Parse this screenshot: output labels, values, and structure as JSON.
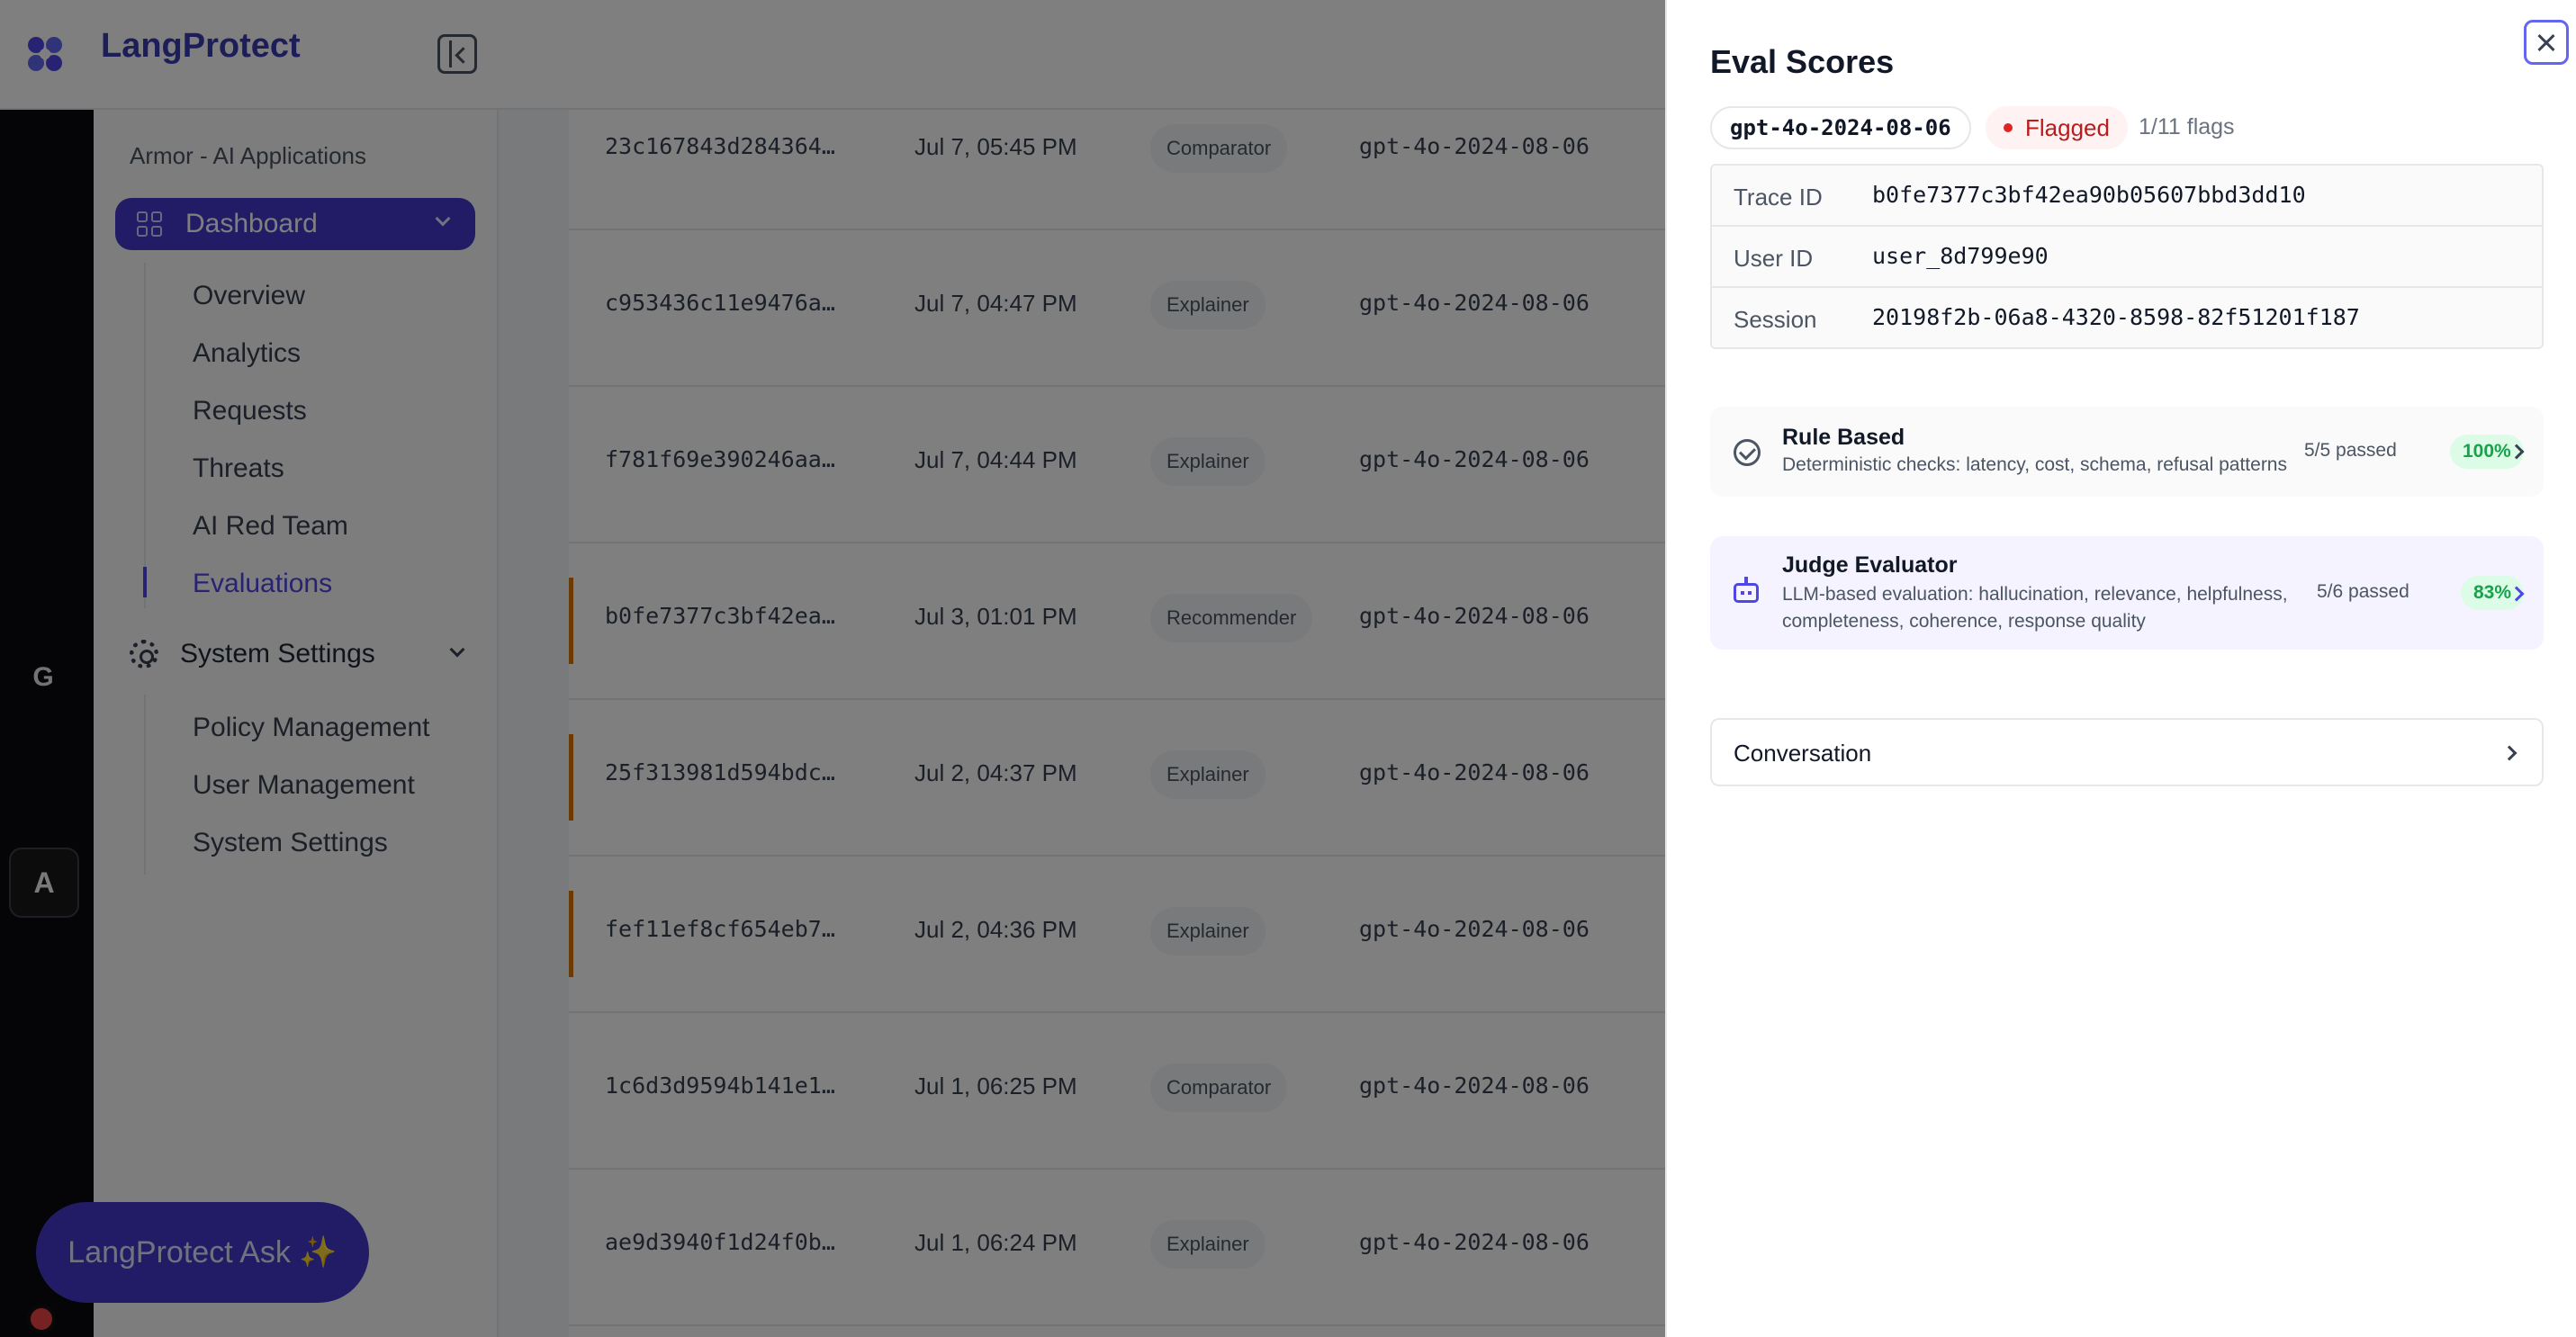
{
  "app": {
    "name": "LangProtect"
  },
  "rail": {
    "letter": "G",
    "avatar": "A"
  },
  "sidebar": {
    "workspace": "Armor - AI Applications",
    "dashboard": "Dashboard",
    "dashboard_items": [
      {
        "label": "Overview"
      },
      {
        "label": "Analytics"
      },
      {
        "label": "Requests"
      },
      {
        "label": "Threats"
      },
      {
        "label": "AI Red Team"
      },
      {
        "label": "Evaluations",
        "active": true
      }
    ],
    "settings": "System Settings",
    "settings_items": [
      {
        "label": "Policy Management"
      },
      {
        "label": "User Management"
      },
      {
        "label": "System Settings"
      }
    ],
    "ask_button": "LangProtect Ask ✨"
  },
  "table": {
    "rows": [
      {
        "id": "23c167843d284364…",
        "time": "Jul 7, 05:45 PM",
        "agent": "Comparator",
        "model": "gpt-4o-2024-08-06",
        "flagged": false
      },
      {
        "id": "c953436c11e9476a…",
        "time": "Jul 7, 04:47 PM",
        "agent": "Explainer",
        "model": "gpt-4o-2024-08-06",
        "flagged": false
      },
      {
        "id": "f781f69e390246aa…",
        "time": "Jul 7, 04:44 PM",
        "agent": "Explainer",
        "model": "gpt-4o-2024-08-06",
        "flagged": false
      },
      {
        "id": "b0fe7377c3bf42ea…",
        "time": "Jul 3, 01:01 PM",
        "agent": "Recommender",
        "model": "gpt-4o-2024-08-06",
        "flagged": true
      },
      {
        "id": "25f313981d594bdc…",
        "time": "Jul 2, 04:37 PM",
        "agent": "Explainer",
        "model": "gpt-4o-2024-08-06",
        "flagged": true
      },
      {
        "id": "fef11ef8cf654eb7…",
        "time": "Jul 2, 04:36 PM",
        "agent": "Explainer",
        "model": "gpt-4o-2024-08-06",
        "flagged": true
      },
      {
        "id": "1c6d3d9594b141e1…",
        "time": "Jul 1, 06:25 PM",
        "agent": "Comparator",
        "model": "gpt-4o-2024-08-06",
        "flagged": false
      },
      {
        "id": "ae9d3940f1d24f0b…",
        "time": "Jul 1, 06:24 PM",
        "agent": "Explainer",
        "model": "gpt-4o-2024-08-06",
        "flagged": false
      }
    ]
  },
  "drawer": {
    "title": "Eval Scores",
    "model": "gpt-4o-2024-08-06",
    "flag_status": "Flagged",
    "flag_count": "1/11 flags",
    "meta": [
      {
        "key": "Trace ID",
        "value": "b0fe7377c3bf42ea90b05607bbd3dd10"
      },
      {
        "key": "User ID",
        "value": "user_8d799e90"
      },
      {
        "key": "Session",
        "value": "20198f2b-06a8-4320-8598-82f51201f187"
      }
    ],
    "rule_based": {
      "title": "Rule Based",
      "description": "Deterministic checks: latency, cost, schema, refusal patterns",
      "passed": "5/5 passed",
      "score": "100%",
      "score_fraction": 1.0
    },
    "judge": {
      "title": "Judge Evaluator",
      "description_line1": "LLM-based evaluation: hallucination, relevance, helpfulness,",
      "description_line2": "completeness, coherence, response quality",
      "passed": "5/6 passed",
      "score": "83%",
      "score_fraction": 0.83
    },
    "conversation": "Conversation"
  },
  "colors": {
    "brand": "#4338ca",
    "flag": "#dc2626",
    "pass_green": "#16a34a",
    "row_flag_marker": "#d97706"
  }
}
